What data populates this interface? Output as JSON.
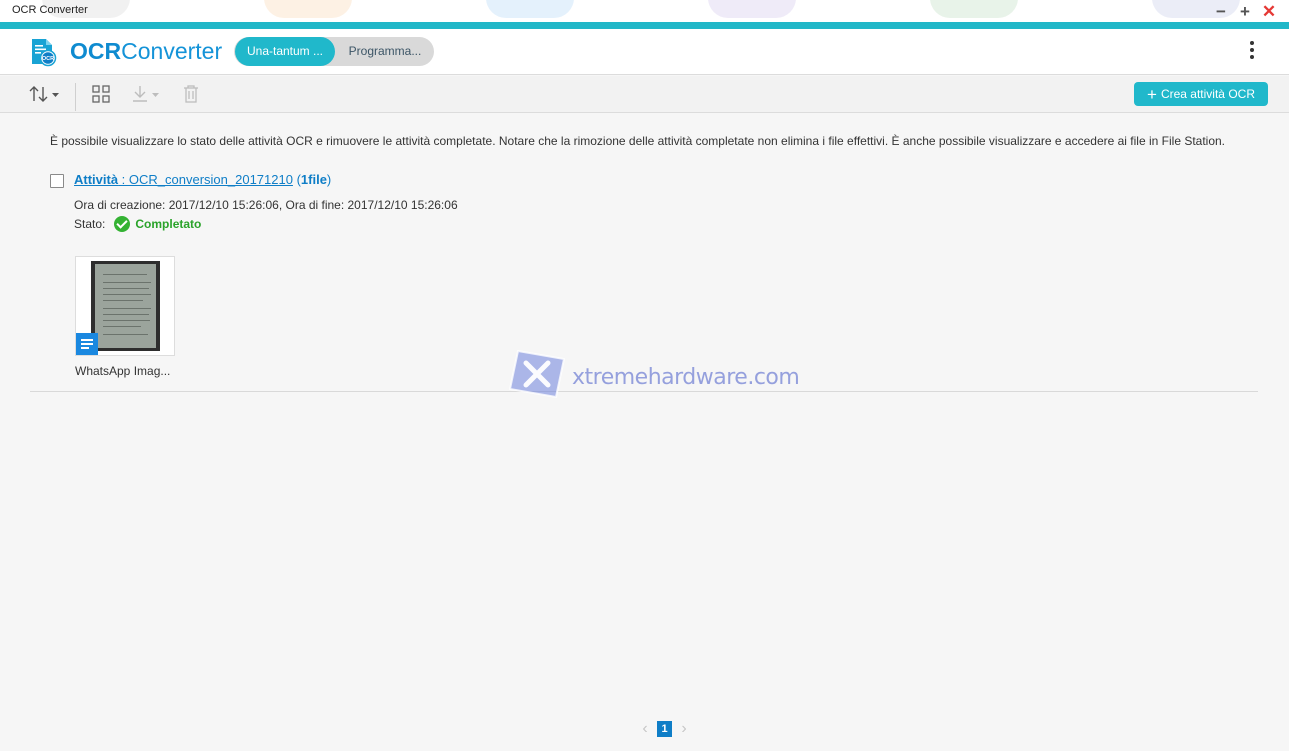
{
  "window": {
    "title": "OCR Converter",
    "minimize_symbol": "−",
    "maximize_symbol": "+",
    "close_symbol": "✕"
  },
  "colors": {
    "accent": "#21b7c8",
    "brand_blue": "#0f8bd0",
    "success": "#34b233",
    "link": "#0f7ec7",
    "close": "#e53935"
  },
  "header": {
    "logo_bold": "OCR",
    "logo_light": "Converter",
    "logo_badge": "OCR",
    "modes": [
      {
        "label": "Una-tantum ...",
        "active": true
      },
      {
        "label": "Programma...",
        "active": false
      }
    ],
    "menu_icon": "kebab-menu-icon"
  },
  "toolbar": {
    "icons": [
      "sort-icon",
      "grid-view-icon",
      "download-icon",
      "trash-icon"
    ],
    "create_label": "Crea attività OCR",
    "create_plus": "+"
  },
  "main": {
    "info": "È possibile visualizzare lo stato delle attività OCR e rimuovere le attività completate. Notare che la rimozione delle attività completate non elimina i file effettivi. È anche possibile visualizzare e accedere ai file in File Station.",
    "task": {
      "label_prefix": "Attività",
      "name": " : OCR_conversion_20171210",
      "count_open": " (",
      "count": "1file",
      "count_close": ")",
      "times": "Ora di creazione: 2017/12/10 15:26:06, Ora di fine: 2017/12/10 15:26:06",
      "status_label": "Stato:",
      "status_value": "Completato"
    },
    "file": {
      "name": "WhatsApp Imag..."
    }
  },
  "watermark": {
    "text": "xtremehardware.com"
  },
  "pagination": {
    "prev": "‹",
    "current": "1",
    "next": "›"
  }
}
